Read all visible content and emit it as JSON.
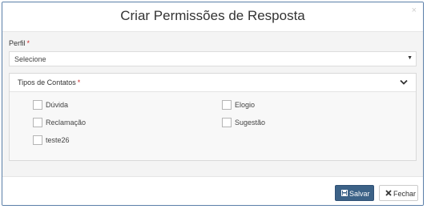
{
  "modal": {
    "title": "Criar Permissões de Resposta",
    "close_label": "×"
  },
  "perfil": {
    "label": "Perfil",
    "required_mark": "*",
    "selected": "Selecione"
  },
  "contatos": {
    "title": "Tipos de Contatos",
    "required_mark": "*",
    "options": [
      {
        "label": "Dúvida",
        "checked": false
      },
      {
        "label": "Elogio",
        "checked": false
      },
      {
        "label": "Reclamação",
        "checked": false
      },
      {
        "label": "Sugestão",
        "checked": false
      },
      {
        "label": "teste26",
        "checked": false
      }
    ]
  },
  "footer": {
    "save_label": "Salvar",
    "close_label": "Fechar"
  },
  "colors": {
    "primary": "#3c6287",
    "border": "#5b7fa8",
    "required": "#cc2a2a"
  },
  "icons": {
    "save": "floppy-disk-icon",
    "close": "times-icon",
    "panel_toggle": "chevron-down-icon",
    "select_caret": "caret-down-icon"
  }
}
